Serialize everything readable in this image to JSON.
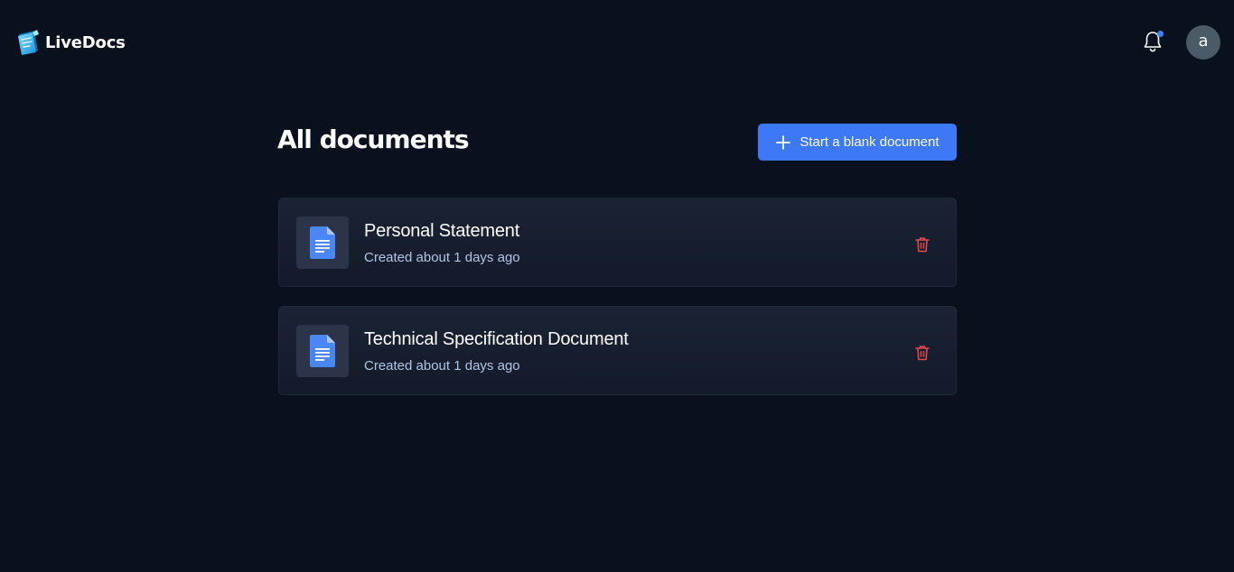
{
  "app": {
    "name": "LiveDocs"
  },
  "header": {
    "avatar_letter": "a",
    "notification_unread": true
  },
  "main": {
    "title": "All documents",
    "new_button_label": "Start a blank document"
  },
  "documents": [
    {
      "title": "Personal Statement",
      "meta": "Created about 1 days ago"
    },
    {
      "title": "Technical Specification Document",
      "meta": "Created about 1 days ago"
    }
  ],
  "icons": {
    "logo": "livedocs-logo-icon",
    "notifications": "bell-icon",
    "new_document": "plus-icon",
    "document": "doc-file-icon",
    "delete": "trash-icon"
  },
  "colors": {
    "background": "#09111f",
    "accent": "#3d79f7",
    "danger": "#e5484d",
    "card": "#1a2334",
    "muted_text": "#b4c4e4"
  }
}
